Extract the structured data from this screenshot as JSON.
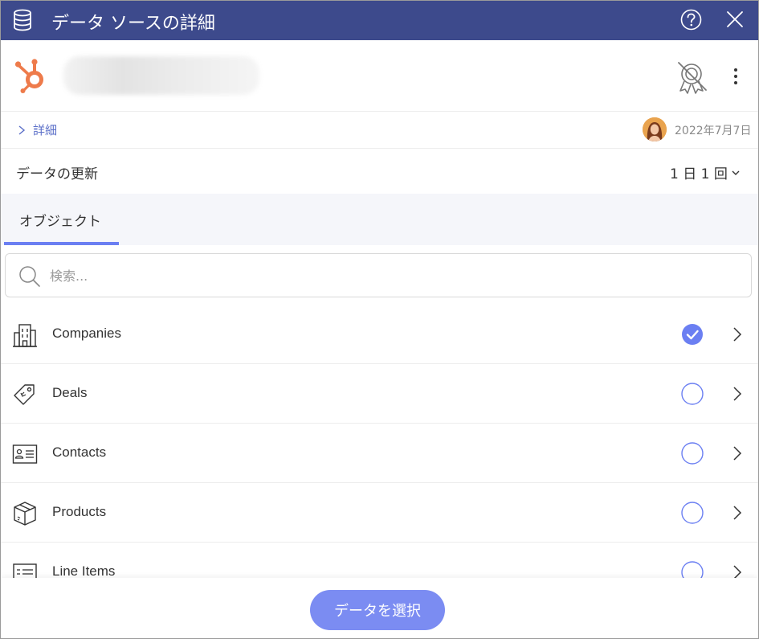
{
  "window": {
    "title": "データ ソースの詳細",
    "icons": {
      "db": "database-icon",
      "help": "help-icon",
      "close": "close-icon"
    }
  },
  "account": {
    "logo": "hubspot-logo",
    "name": "",
    "icons": {
      "certification": "certification-off-icon",
      "more": "more-vertical-icon"
    }
  },
  "details": {
    "link_label": "詳細",
    "date": "2022年7月7日"
  },
  "refresh": {
    "label": "データの更新",
    "value": "1 日 1 回"
  },
  "tabs": [
    {
      "label": "オブジェクト",
      "active": true
    }
  ],
  "search": {
    "placeholder": "検索...",
    "value": ""
  },
  "objects": [
    {
      "label": "Companies",
      "icon": "building-icon",
      "selected": true
    },
    {
      "label": "Deals",
      "icon": "tag-icon",
      "selected": false
    },
    {
      "label": "Contacts",
      "icon": "contact-card-icon",
      "selected": false
    },
    {
      "label": "Products",
      "icon": "box-icon",
      "selected": false
    },
    {
      "label": "Line Items",
      "icon": "line-items-icon",
      "selected": false
    }
  ],
  "footer": {
    "select_button": "データを選択"
  },
  "colors": {
    "titlebar": "#3d4a8c",
    "accent": "#6b7ff2",
    "button": "#7b8cf2",
    "hubspot": "#ee7b4b"
  }
}
